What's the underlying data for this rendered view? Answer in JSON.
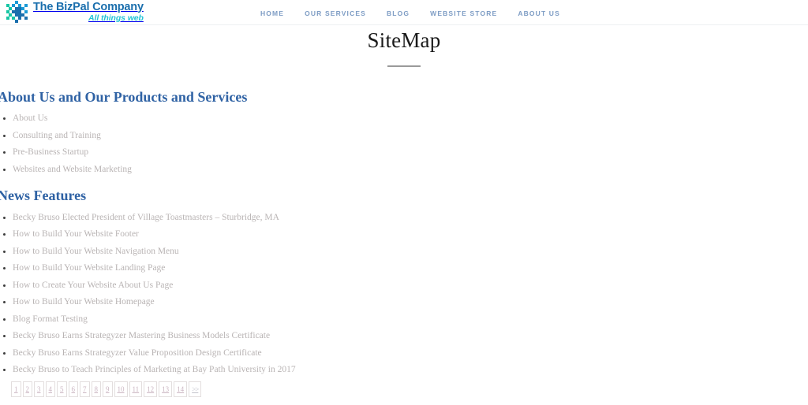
{
  "header": {
    "brand": {
      "name": "The BizPal Company",
      "tagline": "All things web",
      "logo_icon": "mosaic-diamond-logo-icon",
      "name_color": "#1b6fad",
      "tagline_color": "#23c3d6"
    },
    "nav": [
      {
        "label": "HOME",
        "name": "nav-home"
      },
      {
        "label": "OUR SERVICES",
        "name": "nav-our-services"
      },
      {
        "label": "BLOG",
        "name": "nav-blog"
      },
      {
        "label": "WEBSITE STORE",
        "name": "nav-website-store"
      },
      {
        "label": "ABOUT US",
        "name": "nav-about-us"
      }
    ],
    "nav_color": "#7d9cc4"
  },
  "page": {
    "title": "SiteMap"
  },
  "sections": [
    {
      "heading": "About Us and Our Products and Services",
      "heading_color": "#2f62a4",
      "items": [
        "About Us",
        "Consulting and Training",
        "Pre-Business Startup",
        "Websites and Website Marketing"
      ]
    },
    {
      "heading": "News Features",
      "heading_color": "#2f62a4",
      "items": [
        "Becky Bruso Elected President of Village Toastmasters – Sturbridge, MA",
        "How to Build Your Website Footer",
        "How to Build Your Website Navigation Menu",
        "How to Build Your Website Landing Page",
        "How to Create Your Website About Us Page",
        "How to Build Your Website Homepage",
        "Blog Format Testing",
        "Becky Bruso Earns Strategyzer Mastering Business Models Certificate",
        "Becky Bruso Earns Strategyzer Value Proposition Design Certificate",
        "Becky Bruso to Teach Principles of Marketing at Bay Path University in 2017"
      ]
    }
  ],
  "pagination": {
    "pages": [
      "1",
      "2",
      "3",
      "4",
      "5",
      "6",
      "7",
      "8",
      "9",
      "10",
      "11",
      "12",
      "13",
      "14"
    ],
    "next_label": ">>"
  }
}
